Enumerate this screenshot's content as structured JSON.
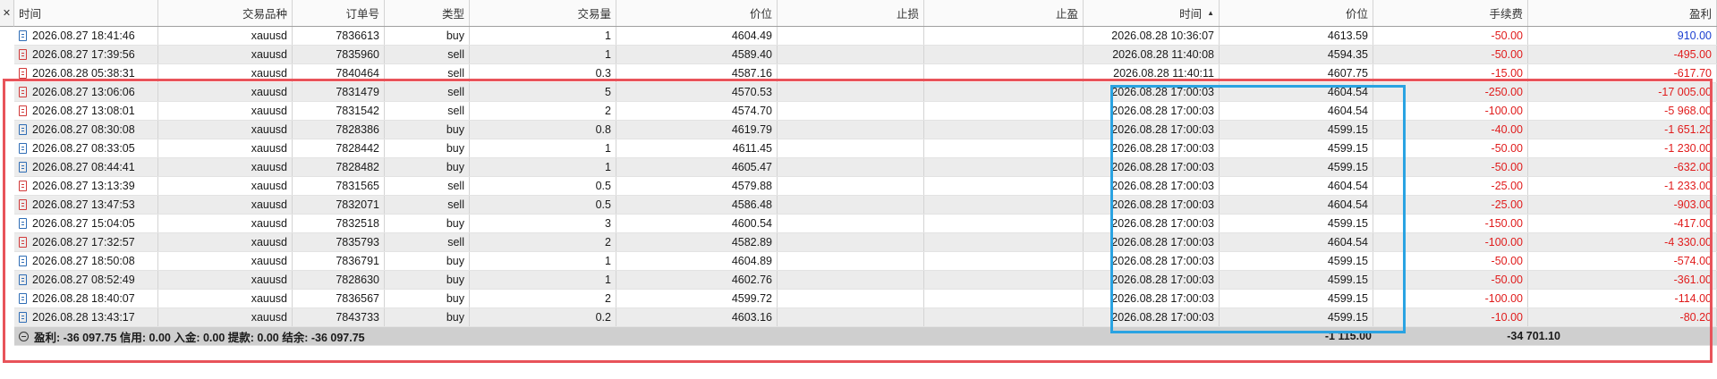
{
  "close_label": "✕",
  "columns": [
    "时间",
    "交易品种",
    "订单号",
    "类型",
    "交易量",
    "价位",
    "止损",
    "止盈",
    "时间",
    "价位",
    "手续费",
    "盈利"
  ],
  "rows": [
    {
      "open_time": "2026.08.27 18:41:46",
      "symbol": "xauusd",
      "order": "7836613",
      "type": "buy",
      "volume": "1",
      "open_price": "4604.49",
      "sl": "",
      "tp": "",
      "close_time": "2026.08.28 10:36:07",
      "close_price": "4613.59",
      "fee": "-50.00",
      "profit": "910.00"
    },
    {
      "open_time": "2026.08.27 17:39:56",
      "symbol": "xauusd",
      "order": "7835960",
      "type": "sell",
      "volume": "1",
      "open_price": "4589.40",
      "sl": "",
      "tp": "",
      "close_time": "2026.08.28 11:40:08",
      "close_price": "4594.35",
      "fee": "-50.00",
      "profit": "-495.00"
    },
    {
      "open_time": "2026.08.28 05:38:31",
      "symbol": "xauusd",
      "order": "7840464",
      "type": "sell",
      "volume": "0.3",
      "open_price": "4587.16",
      "sl": "",
      "tp": "",
      "close_time": "2026.08.28 11:40:11",
      "close_price": "4607.75",
      "fee": "-15.00",
      "profit": "-617.70"
    },
    {
      "open_time": "2026.08.27 13:06:06",
      "symbol": "xauusd",
      "order": "7831479",
      "type": "sell",
      "volume": "5",
      "open_price": "4570.53",
      "sl": "",
      "tp": "",
      "close_time": "2026.08.28 17:00:03",
      "close_price": "4604.54",
      "fee": "-250.00",
      "profit": "-17 005.00"
    },
    {
      "open_time": "2026.08.27 13:08:01",
      "symbol": "xauusd",
      "order": "7831542",
      "type": "sell",
      "volume": "2",
      "open_price": "4574.70",
      "sl": "",
      "tp": "",
      "close_time": "2026.08.28 17:00:03",
      "close_price": "4604.54",
      "fee": "-100.00",
      "profit": "-5 968.00"
    },
    {
      "open_time": "2026.08.27 08:30:08",
      "symbol": "xauusd",
      "order": "7828386",
      "type": "buy",
      "volume": "0.8",
      "open_price": "4619.79",
      "sl": "",
      "tp": "",
      "close_time": "2026.08.28 17:00:03",
      "close_price": "4599.15",
      "fee": "-40.00",
      "profit": "-1 651.20"
    },
    {
      "open_time": "2026.08.27 08:33:05",
      "symbol": "xauusd",
      "order": "7828442",
      "type": "buy",
      "volume": "1",
      "open_price": "4611.45",
      "sl": "",
      "tp": "",
      "close_time": "2026.08.28 17:00:03",
      "close_price": "4599.15",
      "fee": "-50.00",
      "profit": "-1 230.00"
    },
    {
      "open_time": "2026.08.27 08:44:41",
      "symbol": "xauusd",
      "order": "7828482",
      "type": "buy",
      "volume": "1",
      "open_price": "4605.47",
      "sl": "",
      "tp": "",
      "close_time": "2026.08.28 17:00:03",
      "close_price": "4599.15",
      "fee": "-50.00",
      "profit": "-632.00"
    },
    {
      "open_time": "2026.08.27 13:13:39",
      "symbol": "xauusd",
      "order": "7831565",
      "type": "sell",
      "volume": "0.5",
      "open_price": "4579.88",
      "sl": "",
      "tp": "",
      "close_time": "2026.08.28 17:00:03",
      "close_price": "4604.54",
      "fee": "-25.00",
      "profit": "-1 233.00"
    },
    {
      "open_time": "2026.08.27 13:47:53",
      "symbol": "xauusd",
      "order": "7832071",
      "type": "sell",
      "volume": "0.5",
      "open_price": "4586.48",
      "sl": "",
      "tp": "",
      "close_time": "2026.08.28 17:00:03",
      "close_price": "4604.54",
      "fee": "-25.00",
      "profit": "-903.00"
    },
    {
      "open_time": "2026.08.27 15:04:05",
      "symbol": "xauusd",
      "order": "7832518",
      "type": "buy",
      "volume": "3",
      "open_price": "4600.54",
      "sl": "",
      "tp": "",
      "close_time": "2026.08.28 17:00:03",
      "close_price": "4599.15",
      "fee": "-150.00",
      "profit": "-417.00"
    },
    {
      "open_time": "2026.08.27 17:32:57",
      "symbol": "xauusd",
      "order": "7835793",
      "type": "sell",
      "volume": "2",
      "open_price": "4582.89",
      "sl": "",
      "tp": "",
      "close_time": "2026.08.28 17:00:03",
      "close_price": "4604.54",
      "fee": "-100.00",
      "profit": "-4 330.00"
    },
    {
      "open_time": "2026.08.27 18:50:08",
      "symbol": "xauusd",
      "order": "7836791",
      "type": "buy",
      "volume": "1",
      "open_price": "4604.89",
      "sl": "",
      "tp": "",
      "close_time": "2026.08.28 17:00:03",
      "close_price": "4599.15",
      "fee": "-50.00",
      "profit": "-574.00"
    },
    {
      "open_time": "2026.08.27 08:52:49",
      "symbol": "xauusd",
      "order": "7828630",
      "type": "buy",
      "volume": "1",
      "open_price": "4602.76",
      "sl": "",
      "tp": "",
      "close_time": "2026.08.28 17:00:03",
      "close_price": "4599.15",
      "fee": "-50.00",
      "profit": "-361.00"
    },
    {
      "open_time": "2026.08.28 18:40:07",
      "symbol": "xauusd",
      "order": "7836567",
      "type": "buy",
      "volume": "2",
      "open_price": "4599.72",
      "sl": "",
      "tp": "",
      "close_time": "2026.08.28 17:00:03",
      "close_price": "4599.15",
      "fee": "-100.00",
      "profit": "-114.00"
    },
    {
      "open_time": "2026.08.28 13:43:17",
      "symbol": "xauusd",
      "order": "7843733",
      "type": "buy",
      "volume": "0.2",
      "open_price": "4603.16",
      "sl": "",
      "tp": "",
      "close_time": "2026.08.28 17:00:03",
      "close_price": "4599.15",
      "fee": "-10.00",
      "profit": "-80.20"
    }
  ],
  "summary": {
    "text": "盈利: -36 097.75  信用: 0.00  入金: 0.00  提款: 0.00  结余: -36 097.75",
    "fee_total": "-1 115.00",
    "profit_total": "-34 701.10"
  },
  "colors": {
    "negative": "#e01c1c",
    "positive": "#1c3fd0",
    "highlight_red": "#e8535a",
    "highlight_blue": "#2aa3e2",
    "buy_icon": "#2f6db5",
    "sell_icon": "#d13a3a"
  },
  "icons": {
    "buy": "order-doc-blue-icon",
    "sell": "order-doc-red-icon",
    "collapse": "collapse-minus-icon",
    "sort": "sort-ascending-icon"
  }
}
